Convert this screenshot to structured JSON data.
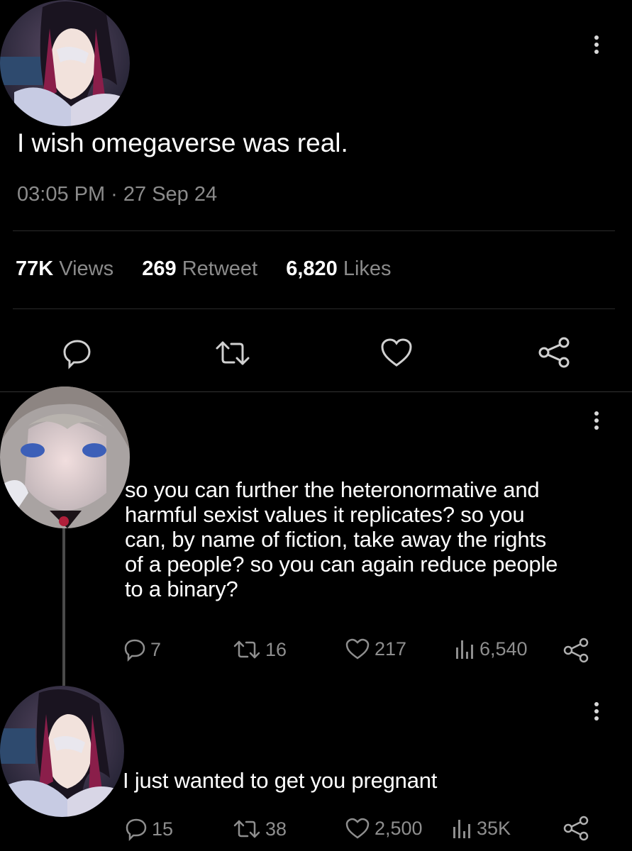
{
  "main_tweet": {
    "text": "I wish omegaverse was real.",
    "timestamp": "03:05 PM · 27 Sep 24",
    "stats": {
      "views_count": "77K",
      "views_label": "Views",
      "retweet_count": "269",
      "retweet_label": "Retweet",
      "likes_count": "6,820",
      "likes_label": "Likes"
    }
  },
  "reply_1": {
    "lines": [
      "so you can further the heteronormative and",
      "harmful sexist values it replicates? so you",
      "can, by name of fiction, take away the rights",
      "of a people? so you can again reduce people",
      "to a binary?"
    ],
    "actions": {
      "replies": "7",
      "retweets": "16",
      "likes": "217",
      "views": "6,540"
    }
  },
  "reply_2": {
    "text": "I just wanted to get you pregnant",
    "actions": {
      "replies": "15",
      "retweets": "38",
      "likes": "2,500",
      "views": "35K"
    }
  },
  "icons": {
    "more": "more-vertical-icon",
    "reply": "reply-icon",
    "retweet": "retweet-icon",
    "like": "heart-icon",
    "share": "share-icon",
    "views": "views-icon"
  },
  "colors": {
    "background": "#000000",
    "text": "#ffffff",
    "muted": "#8b8b8b"
  }
}
